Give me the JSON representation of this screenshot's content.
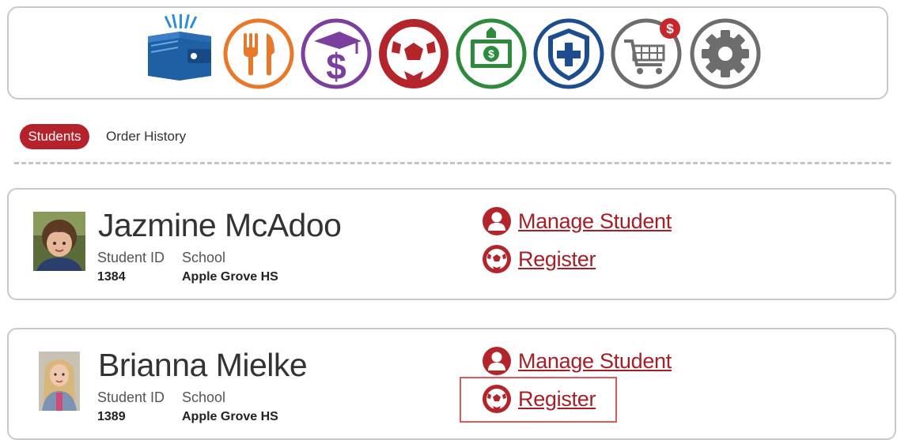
{
  "toolbar": {
    "icons": [
      {
        "name": "wallet-book-icon",
        "color": "#1f5fa3"
      },
      {
        "name": "fork-knife-icon",
        "color": "#e8792a"
      },
      {
        "name": "graduation-dollar-icon",
        "color": "#7b3f9e"
      },
      {
        "name": "soccer-ball-icon",
        "color": "#b3252b"
      },
      {
        "name": "money-bill-icon",
        "color": "#2e8b3b"
      },
      {
        "name": "medical-shield-icon",
        "color": "#1d4d8f"
      },
      {
        "name": "shopping-cart-icon",
        "color": "#6d6d6d",
        "badge": "$"
      },
      {
        "name": "gear-icon",
        "color": "#6d6d6d"
      }
    ]
  },
  "tabs": {
    "students": "Students",
    "order_history": "Order History"
  },
  "labels": {
    "student_id": "Student ID",
    "school": "School",
    "manage": "Manage Student",
    "register": "Register"
  },
  "students": [
    {
      "name": "Jazmine McAdoo",
      "id": "1384",
      "school": "Apple Grove HS"
    },
    {
      "name": "Brianna Mielke",
      "id": "1389",
      "school": "Apple Grove HS"
    }
  ],
  "colors": {
    "accent": "#b5222a",
    "link": "#a51f26",
    "highlight": "#e0585b",
    "border": "#c9c9c9"
  }
}
